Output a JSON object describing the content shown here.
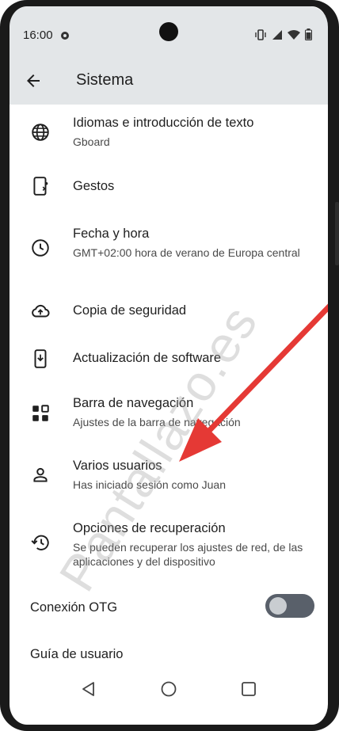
{
  "status": {
    "time": "16:00"
  },
  "appbar": {
    "title": "Sistema"
  },
  "items": [
    {
      "title": "Idiomas e introducción de texto",
      "subtitle": "Gboard",
      "icon": "globe-icon"
    },
    {
      "title": "Gestos",
      "subtitle": "",
      "icon": "gestures-phone-icon"
    },
    {
      "title": "Fecha y hora",
      "subtitle": "GMT+02:00 hora de verano de Europa central",
      "icon": "clock-icon"
    },
    {
      "title": "Copia de seguridad",
      "subtitle": "",
      "icon": "cloud-upload-icon"
    },
    {
      "title": "Actualización de software",
      "subtitle": "",
      "icon": "system-update-icon"
    },
    {
      "title": "Barra de navegación",
      "subtitle": "Ajustes de la barra de navegación",
      "icon": "navigation-bar-icon"
    },
    {
      "title": "Varios usuarios",
      "subtitle": "Has iniciado sesión como Juan",
      "icon": "person-icon"
    },
    {
      "title": "Opciones de recuperación",
      "subtitle": "Se pueden recuperar los ajustes de red, de las aplicaciones y del dispositivo",
      "icon": "restore-icon"
    }
  ],
  "otg": {
    "label": "Conexión OTG",
    "enabled": false
  },
  "guide": {
    "label": "Guía de usuario"
  },
  "watermark": "Pantallazo.es",
  "accent": "#e53935"
}
